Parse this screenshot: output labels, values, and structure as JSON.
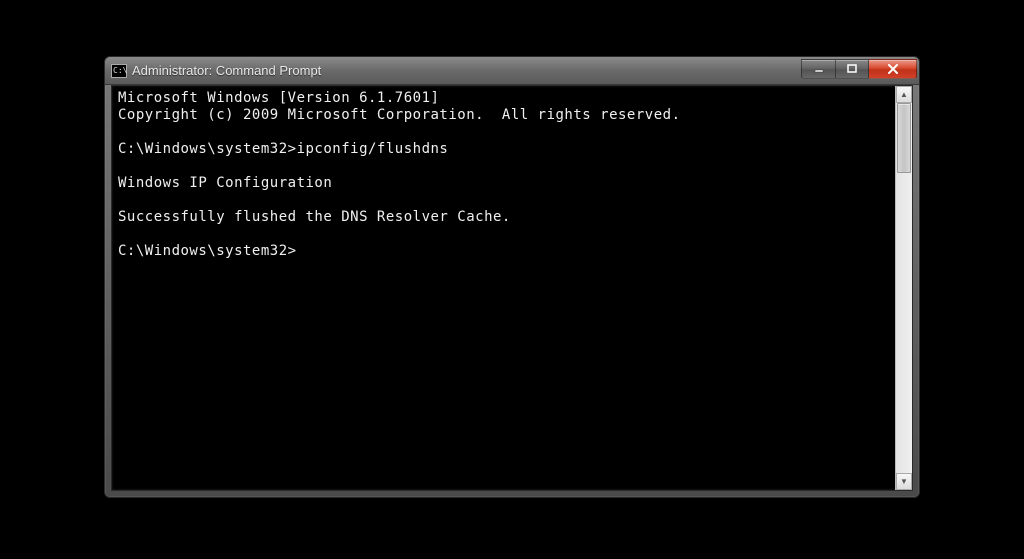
{
  "window": {
    "title": "Administrator: Command Prompt",
    "icon_text": "C:\\"
  },
  "terminal": {
    "lines": [
      "Microsoft Windows [Version 6.1.7601]",
      "Copyright (c) 2009 Microsoft Corporation.  All rights reserved.",
      "",
      "C:\\Windows\\system32>ipconfig/flushdns",
      "",
      "Windows IP Configuration",
      "",
      "Successfully flushed the DNS Resolver Cache.",
      "",
      "C:\\Windows\\system32>"
    ]
  },
  "scrollbar": {
    "up_glyph": "▲",
    "down_glyph": "▼"
  }
}
